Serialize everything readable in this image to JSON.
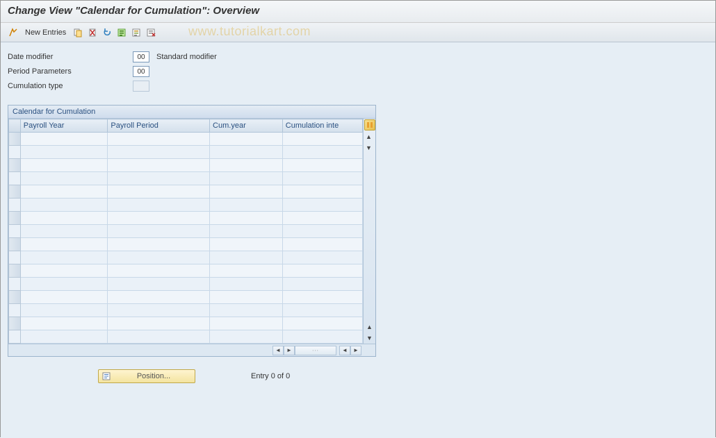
{
  "title": "Change View \"Calendar for Cumulation\": Overview",
  "toolbar": {
    "new_entries": "New Entries"
  },
  "watermark": "www.tutorialkart.com",
  "form": {
    "date_modifier": {
      "label": "Date modifier",
      "value": "00",
      "desc": "Standard modifier"
    },
    "period_params": {
      "label": "Period Parameters",
      "value": "00"
    },
    "cumulation_type": {
      "label": "Cumulation type",
      "value": ""
    }
  },
  "table": {
    "title": "Calendar for Cumulation",
    "columns": [
      "Payroll Year",
      "Payroll Period",
      "Cum.year",
      "Cumulation inte"
    ],
    "row_count": 16
  },
  "footer": {
    "position_label": "Position...",
    "entry_text": "Entry 0 of 0"
  }
}
